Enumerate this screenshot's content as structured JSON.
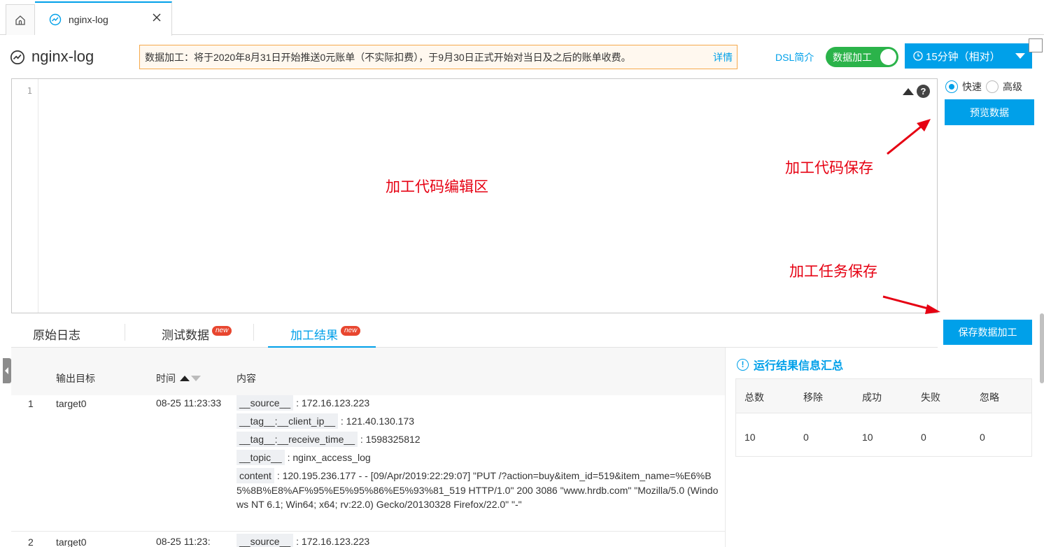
{
  "tabs": {
    "file_tab_label": "nginx-log"
  },
  "header": {
    "title": "nginx-log",
    "notice_text": "数据加工：将于2020年8月31日开始推送0元账单（不实际扣费），于9月30日正式开始对当日及之后的账单收费。",
    "notice_link": "详情",
    "dsl_link": "DSL简介",
    "toggle_label": "数据加工",
    "time_range": "15分钟（相对）",
    "accent_color": "#00a0e9"
  },
  "editor": {
    "line_number": "1",
    "center_note": "加工代码编辑区",
    "help_glyph": "?"
  },
  "right_panel": {
    "mode_fast": "快速",
    "mode_advanced": "高级",
    "preview_button": "预览数据",
    "note_save_code": "加工代码保存",
    "note_save_task": "加工任务保存",
    "save_button": "保存数据加工"
  },
  "bottom_tabs": {
    "raw": "原始日志",
    "test": "测试数据",
    "result": "加工结果",
    "badge": "new"
  },
  "result_table": {
    "headers": {
      "target": "输出目标",
      "time": "时间",
      "content": "内容"
    },
    "rows": [
      {
        "index": "1",
        "target": "target0",
        "time": "08-25 11:23:33",
        "fields": [
          {
            "key": "__source__",
            "value": ": 172.16.123.223"
          },
          {
            "key": "__tag__:__client_ip__",
            "value": ": 121.40.130.173"
          },
          {
            "key": "__tag__:__receive_time__",
            "value": ": 1598325812"
          },
          {
            "key": "__topic__",
            "value": ": nginx_access_log"
          }
        ],
        "content_key": "content",
        "content_value": ": 120.195.236.177 - - [09/Apr/2019:22:29:07] \"PUT /?action=buy&item_id=519&item_name=%E6%B5%8B%E8%AF%95%E5%95%86%E5%93%81_519 HTTP/1.0\" 200 3086 \"www.hrdb.com\" \"Mozilla/5.0 (Windows NT 6.1; Win64; x64; rv:22.0) Gecko/20130328 Firefox/22.0\" \"-\""
      },
      {
        "index": "2",
        "target": "target0",
        "time": "08-25 11:23:",
        "fields": [
          {
            "key": "__source__",
            "value": ": 172.16.123.223"
          }
        ]
      }
    ]
  },
  "summary": {
    "title": "运行结果信息汇总",
    "columns": [
      "总数",
      "移除",
      "成功",
      "失败",
      "忽略"
    ],
    "values": [
      "10",
      "0",
      "10",
      "0",
      "0"
    ]
  }
}
